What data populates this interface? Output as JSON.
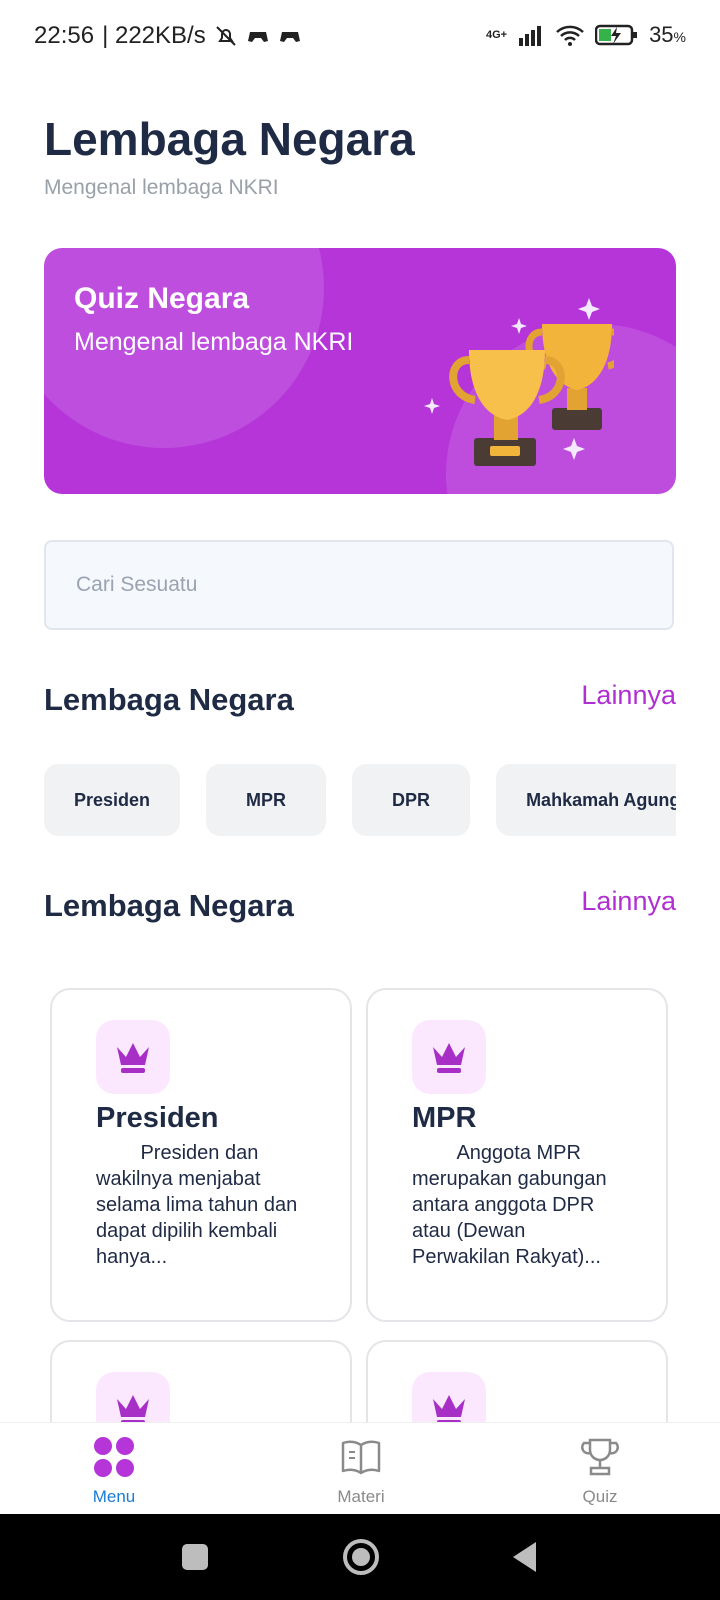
{
  "status_bar": {
    "time": "22:56",
    "speed": "| 222KB/s",
    "network": "4G+",
    "battery": "35",
    "battery_unit": "%",
    "icons": [
      "mute-bell-icon",
      "game-controller-icon",
      "game-controller-icon",
      "signal-icon",
      "wifi-icon",
      "battery-charging-icon"
    ]
  },
  "header": {
    "title": "Lembaga Negara",
    "subtitle": "Mengenal lembaga NKRI"
  },
  "banner": {
    "title": "Quiz Negara",
    "subtitle": "Mengenal lembaga NKRI",
    "image": "trophy-icon",
    "color": "#b535d9"
  },
  "search": {
    "placeholder": "Cari Sesuatu",
    "value": ""
  },
  "section1": {
    "title": "Lembaga Negara",
    "more": "Lainnya",
    "chips": [
      "Presiden",
      "MPR",
      "DPR",
      "Mahkamah Agung"
    ]
  },
  "section2": {
    "title": "Lembaga Negara",
    "more": "Lainnya",
    "cards": [
      {
        "icon": "crown-icon",
        "title": "Presiden",
        "desc": "        Presiden dan wakilnya menjabat selama lima tahun dan dapat dipilih kembali hanya..."
      },
      {
        "icon": "crown-icon",
        "title": "MPR",
        "desc": "        Anggota MPR merupakan gabungan antara anggota DPR atau (Dewan Perwakilan Rakyat)..."
      },
      {
        "icon": "crown-icon",
        "title": "",
        "desc": ""
      },
      {
        "icon": "crown-icon",
        "title": "",
        "desc": ""
      }
    ]
  },
  "bottom_nav": {
    "items": [
      {
        "label": "Menu",
        "icon": "grid-icon",
        "active": true
      },
      {
        "label": "Materi",
        "icon": "book-icon",
        "active": false
      },
      {
        "label": "Quiz",
        "icon": "trophy-icon",
        "active": false
      }
    ],
    "active_color": "#1b7bd6",
    "accent": "#b535d9"
  },
  "system_nav": [
    "recents-button",
    "home-button",
    "back-button"
  ]
}
